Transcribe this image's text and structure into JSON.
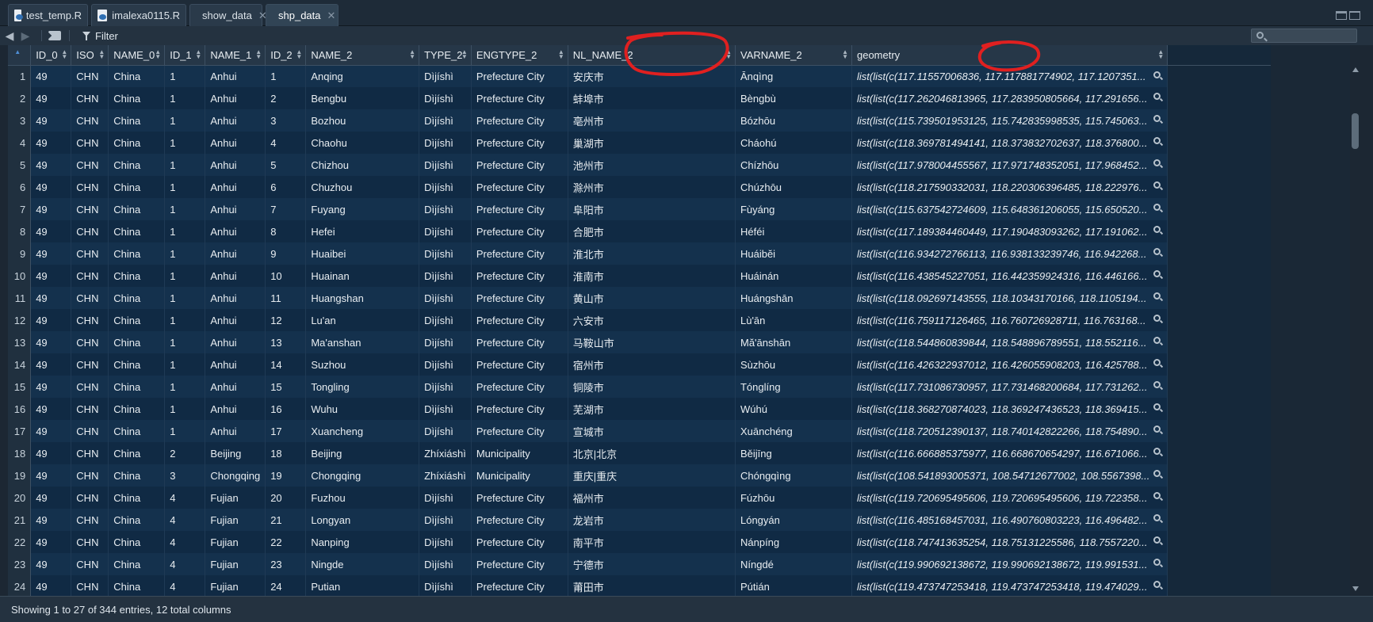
{
  "tabs": [
    {
      "label": "test_temp.R",
      "icon": "r-file-icon",
      "active": false
    },
    {
      "label": "imalexa0115.R",
      "icon": "r-file-icon",
      "active": false
    },
    {
      "label": "show_data",
      "icon": "data-grid-icon",
      "active": false
    },
    {
      "label": "shp_data",
      "icon": "data-grid-icon",
      "active": true
    }
  ],
  "toolbar": {
    "filter_label": "Filter",
    "search_placeholder": ""
  },
  "columns": [
    "",
    "ID_0",
    "ISO",
    "NAME_0",
    "ID_1",
    "NAME_1",
    "ID_2",
    "NAME_2",
    "TYPE_2",
    "ENGTYPE_2",
    "NL_NAME_2",
    "VARNAME_2",
    "geometry"
  ],
  "rows": [
    [
      "1",
      "49",
      "CHN",
      "China",
      "1",
      "Anhui",
      "1",
      "Anqing",
      "Dìjíshì",
      "Prefecture City",
      "安庆市",
      "Ānqìng",
      "list(list(c(117.11557006836, 117.117881774902, 117.1207351..."
    ],
    [
      "2",
      "49",
      "CHN",
      "China",
      "1",
      "Anhui",
      "2",
      "Bengbu",
      "Dìjíshì",
      "Prefecture City",
      "蚌埠市",
      "Bèngbù",
      "list(list(c(117.262046813965, 117.283950805664, 117.291656..."
    ],
    [
      "3",
      "49",
      "CHN",
      "China",
      "1",
      "Anhui",
      "3",
      "Bozhou",
      "Dìjíshì",
      "Prefecture City",
      "亳州市",
      "Bózhōu",
      "list(list(c(115.739501953125, 115.742835998535, 115.745063..."
    ],
    [
      "4",
      "49",
      "CHN",
      "China",
      "1",
      "Anhui",
      "4",
      "Chaohu",
      "Dìjíshì",
      "Prefecture City",
      "巢湖市",
      "Cháohú",
      "list(list(c(118.369781494141, 118.373832702637, 118.376800..."
    ],
    [
      "5",
      "49",
      "CHN",
      "China",
      "1",
      "Anhui",
      "5",
      "Chizhou",
      "Dìjíshì",
      "Prefecture City",
      "池州市",
      "Chízhōu",
      "list(list(c(117.978004455567, 117.971748352051, 117.968452..."
    ],
    [
      "6",
      "49",
      "CHN",
      "China",
      "1",
      "Anhui",
      "6",
      "Chuzhou",
      "Dìjíshì",
      "Prefecture City",
      "滁州市",
      "Chúzhōu",
      "list(list(c(118.217590332031, 118.220306396485, 118.222976..."
    ],
    [
      "7",
      "49",
      "CHN",
      "China",
      "1",
      "Anhui",
      "7",
      "Fuyang",
      "Dìjíshì",
      "Prefecture City",
      "阜阳市",
      "Fùyáng",
      "list(list(c(115.637542724609, 115.648361206055, 115.650520..."
    ],
    [
      "8",
      "49",
      "CHN",
      "China",
      "1",
      "Anhui",
      "8",
      "Hefei",
      "Dìjíshì",
      "Prefecture City",
      "合肥市",
      "Héféi",
      "list(list(c(117.189384460449, 117.190483093262, 117.191062..."
    ],
    [
      "9",
      "49",
      "CHN",
      "China",
      "1",
      "Anhui",
      "9",
      "Huaibei",
      "Dìjíshì",
      "Prefecture City",
      "淮北市",
      "Huáibĕi",
      "list(list(c(116.934272766113, 116.938133239746, 116.942268..."
    ],
    [
      "10",
      "49",
      "CHN",
      "China",
      "1",
      "Anhui",
      "10",
      "Huainan",
      "Dìjíshì",
      "Prefecture City",
      "淮南市",
      "Huáinán",
      "list(list(c(116.438545227051, 116.442359924316, 116.446166..."
    ],
    [
      "11",
      "49",
      "CHN",
      "China",
      "1",
      "Anhui",
      "11",
      "Huangshan",
      "Dìjíshì",
      "Prefecture City",
      "黄山市",
      "Huángshān",
      "list(list(c(118.092697143555, 118.10343170166, 118.1105194..."
    ],
    [
      "12",
      "49",
      "CHN",
      "China",
      "1",
      "Anhui",
      "12",
      "Lu'an",
      "Dìjíshì",
      "Prefecture City",
      "六安市",
      "Lù'ān",
      "list(list(c(116.759117126465, 116.760726928711, 116.763168..."
    ],
    [
      "13",
      "49",
      "CHN",
      "China",
      "1",
      "Anhui",
      "13",
      "Ma'anshan",
      "Dìjíshì",
      "Prefecture City",
      "马鞍山市",
      "Mă'ānshān",
      "list(list(c(118.544860839844, 118.548896789551, 118.552116..."
    ],
    [
      "14",
      "49",
      "CHN",
      "China",
      "1",
      "Anhui",
      "14",
      "Suzhou",
      "Dìjíshì",
      "Prefecture City",
      "宿州市",
      "Sùzhōu",
      "list(list(c(116.426322937012, 116.426055908203, 116.425788..."
    ],
    [
      "15",
      "49",
      "CHN",
      "China",
      "1",
      "Anhui",
      "15",
      "Tongling",
      "Dìjíshì",
      "Prefecture City",
      "铜陵市",
      "Tónglíng",
      "list(list(c(117.731086730957, 117.731468200684, 117.731262..."
    ],
    [
      "16",
      "49",
      "CHN",
      "China",
      "1",
      "Anhui",
      "16",
      "Wuhu",
      "Dìjíshì",
      "Prefecture City",
      "芜湖市",
      "Wúhú",
      "list(list(c(118.368270874023, 118.369247436523, 118.369415..."
    ],
    [
      "17",
      "49",
      "CHN",
      "China",
      "1",
      "Anhui",
      "17",
      "Xuancheng",
      "Dìjíshì",
      "Prefecture City",
      "宣城市",
      "Xuānchéng",
      "list(list(c(118.720512390137, 118.740142822266, 118.754890..."
    ],
    [
      "18",
      "49",
      "CHN",
      "China",
      "2",
      "Beijing",
      "18",
      "Beijing",
      "Zhíxiáshì",
      "Municipality",
      "北京|北京",
      "Běijīng",
      "list(list(c(116.666885375977, 116.668670654297, 116.671066..."
    ],
    [
      "19",
      "49",
      "CHN",
      "China",
      "3",
      "Chongqing",
      "19",
      "Chongqing",
      "Zhíxiáshì",
      "Municipality",
      "重庆|重庆",
      "Chóngqìng",
      "list(list(c(108.541893005371, 108.54712677002, 108.5567398..."
    ],
    [
      "20",
      "49",
      "CHN",
      "China",
      "4",
      "Fujian",
      "20",
      "Fuzhou",
      "Dìjíshì",
      "Prefecture City",
      "福州市",
      "Fúzhōu",
      "list(list(c(119.720695495606, 119.720695495606, 119.722358..."
    ],
    [
      "21",
      "49",
      "CHN",
      "China",
      "4",
      "Fujian",
      "21",
      "Longyan",
      "Dìjíshì",
      "Prefecture City",
      "龙岩市",
      "Lóngyán",
      "list(list(c(116.485168457031, 116.490760803223, 116.496482..."
    ],
    [
      "22",
      "49",
      "CHN",
      "China",
      "4",
      "Fujian",
      "22",
      "Nanping",
      "Dìjíshì",
      "Prefecture City",
      "南平市",
      "Nánpíng",
      "list(list(c(118.747413635254, 118.75131225586, 118.7557220..."
    ],
    [
      "23",
      "49",
      "CHN",
      "China",
      "4",
      "Fujian",
      "23",
      "Ningde",
      "Dìjíshì",
      "Prefecture City",
      "宁德市",
      "Níngdé",
      "list(list(c(119.990692138672, 119.990692138672, 119.991531..."
    ],
    [
      "24",
      "49",
      "CHN",
      "China",
      "4",
      "Fujian",
      "24",
      "Putian",
      "Dìjíshì",
      "Prefecture City",
      "莆田市",
      "Pútián",
      "list(list(c(119.473747253418, 119.473747253418, 119.474029..."
    ]
  ],
  "status": {
    "text": "Showing 1 to 27 of 344 entries, 12 total columns"
  },
  "colors": {
    "annotation": "#e02020",
    "grid_bg": "#0f2a44",
    "header_bg": "#263748"
  }
}
